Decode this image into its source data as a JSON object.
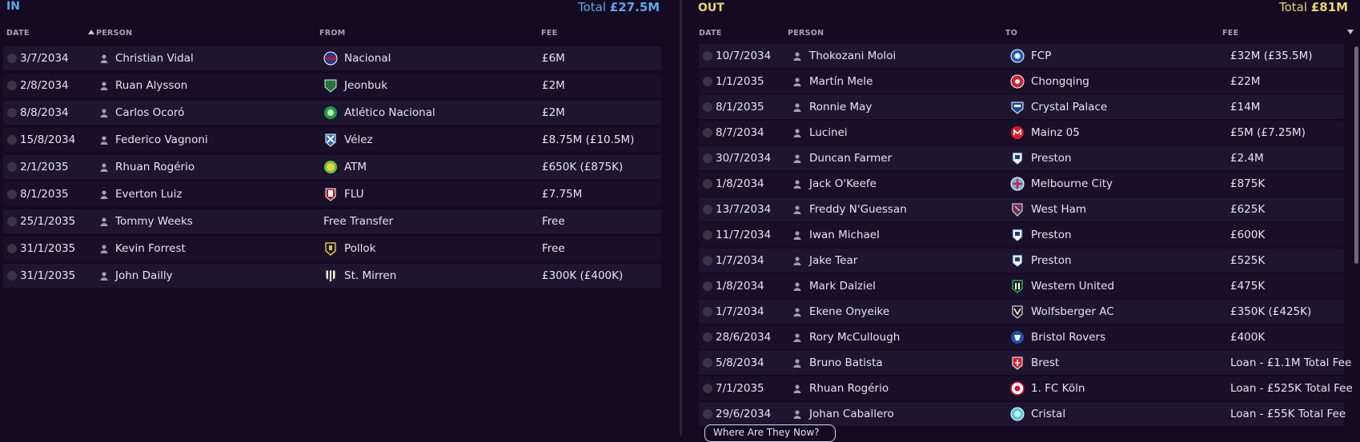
{
  "in": {
    "title": "IN",
    "total_label": "Total",
    "total_value": "£27.5M",
    "columns": [
      "DATE",
      "PERSON",
      "FROM",
      "FEE"
    ],
    "rows": [
      {
        "date": "3/7/2034",
        "person": "Christian Vidal",
        "club": "Nacional",
        "fee": "£6M",
        "crest": "nacional-crest-icon"
      },
      {
        "date": "2/8/2034",
        "person": "Ruan Alysson",
        "club": "Jeonbuk",
        "fee": "£2M",
        "crest": "jeonbuk-crest-icon"
      },
      {
        "date": "8/8/2034",
        "person": "Carlos Ocoró",
        "club": "Atlético Nacional",
        "fee": "£2M",
        "crest": "atletico-nacional-crest-icon"
      },
      {
        "date": "15/8/2034",
        "person": "Federico Vagnoni",
        "club": "Vélez",
        "fee": "£8.75M (£10.5M)",
        "crest": "velez-crest-icon"
      },
      {
        "date": "2/1/2035",
        "person": "Rhuan Rogério",
        "club": "ATM",
        "fee": "£650K (£875K)",
        "crest": "atm-crest-icon"
      },
      {
        "date": "8/1/2035",
        "person": "Everton Luiz",
        "club": "FLU",
        "fee": "£7.75M",
        "crest": "flu-crest-icon"
      },
      {
        "date": "25/1/2035",
        "person": "Tommy Weeks",
        "club": "Free Transfer",
        "fee": "Free",
        "crest": ""
      },
      {
        "date": "31/1/2035",
        "person": "Kevin Forrest",
        "club": "Pollok",
        "fee": "Free",
        "crest": "pollok-crest-icon"
      },
      {
        "date": "31/1/2035",
        "person": "John Dailly",
        "club": "St. Mirren",
        "fee": "£300K (£400K)",
        "crest": "st-mirren-crest-icon"
      }
    ]
  },
  "out": {
    "title": "OUT",
    "total_label": "Total",
    "total_value": "£81M",
    "columns": [
      "DATE",
      "PERSON",
      "TO",
      "FEE"
    ],
    "rows": [
      {
        "date": "10/7/2034",
        "person": "Thokozani Moloi",
        "club": "FCP",
        "fee": "£32M (£35.5M)",
        "crest": "fcp-crest-icon"
      },
      {
        "date": "1/1/2035",
        "person": "Martín Mele",
        "club": "Chongqing",
        "fee": "£22M",
        "crest": "chongqing-crest-icon"
      },
      {
        "date": "8/1/2035",
        "person": "Ronnie May",
        "club": "Crystal Palace",
        "fee": "£14M",
        "crest": "crystal-palace-crest-icon"
      },
      {
        "date": "8/7/2034",
        "person": "Lucinei",
        "club": "Mainz 05",
        "fee": "£5M (£7.25M)",
        "crest": "mainz-crest-icon"
      },
      {
        "date": "30/7/2034",
        "person": "Duncan Farmer",
        "club": "Preston",
        "fee": "£2.4M",
        "crest": "preston-crest-icon"
      },
      {
        "date": "1/8/2034",
        "person": "Jack O'Keefe",
        "club": "Melbourne City",
        "fee": "£875K",
        "crest": "melbourne-city-crest-icon"
      },
      {
        "date": "13/7/2034",
        "person": "Freddy N'Guessan",
        "club": "West Ham",
        "fee": "£625K",
        "crest": "west-ham-crest-icon"
      },
      {
        "date": "11/7/2034",
        "person": "Iwan Michael",
        "club": "Preston",
        "fee": "£600K",
        "crest": "preston-crest-icon"
      },
      {
        "date": "1/7/2034",
        "person": "Jake Tear",
        "club": "Preston",
        "fee": "£525K",
        "crest": "preston-crest-icon"
      },
      {
        "date": "1/8/2034",
        "person": "Mark Dalziel",
        "club": "Western United",
        "fee": "£475K",
        "crest": "western-united-crest-icon"
      },
      {
        "date": "1/7/2034",
        "person": "Ekene Onyeike",
        "club": "Wolfsberger AC",
        "fee": "£350K (£425K)",
        "crest": "wolfsberger-crest-icon"
      },
      {
        "date": "28/6/2034",
        "person": "Rory McCullough",
        "club": "Bristol Rovers",
        "fee": "£400K",
        "crest": "bristol-rovers-crest-icon"
      },
      {
        "date": "5/8/2034",
        "person": "Bruno Batista",
        "club": "Brest",
        "fee": "Loan - £1.1M Total Fee",
        "crest": "brest-crest-icon"
      },
      {
        "date": "7/1/2035",
        "person": "Rhuan Rogério",
        "club": "1. FC Köln",
        "fee": "Loan - £525K Total Fee",
        "crest": "koln-crest-icon"
      },
      {
        "date": "29/6/2034",
        "person": "Johan Caballero",
        "club": "Cristal",
        "fee": "Loan - £55K Total Fee",
        "crest": "cristal-crest-icon"
      }
    ]
  },
  "footer": {
    "button_label": "Where Are They Now?"
  },
  "colors": {
    "in_accent": "#5aa9e8",
    "out_accent": "#e8d86a",
    "background": "#150a22",
    "row_bg": "#1e1530"
  }
}
